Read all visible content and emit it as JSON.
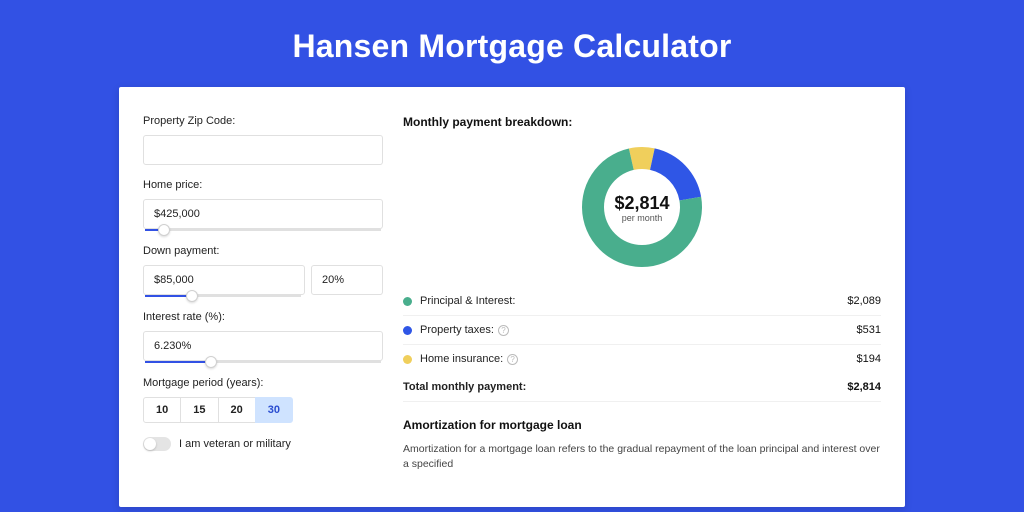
{
  "page_title": "Hansen Mortgage Calculator",
  "form": {
    "zip": {
      "label": "Property Zip Code:",
      "value": ""
    },
    "home_price": {
      "label": "Home price:",
      "value": "$425,000",
      "slider_pct": 8
    },
    "down_payment": {
      "label": "Down payment:",
      "amount": "$85,000",
      "percent": "20%",
      "slider_pct": 18
    },
    "interest": {
      "label": "Interest rate (%):",
      "value": "6.230%",
      "slider_pct": 28
    },
    "period": {
      "label": "Mortgage period (years):",
      "options": [
        "10",
        "15",
        "20",
        "30"
      ],
      "selected": "30"
    },
    "veteran": {
      "label": "I am veteran or military",
      "on": false
    }
  },
  "breakdown": {
    "title": "Monthly payment breakdown:",
    "center_amount": "$2,814",
    "center_sub": "per month",
    "items": [
      {
        "key": "pi",
        "label": "Principal & Interest:",
        "value": "$2,089",
        "color": "#49ae8d",
        "info": false
      },
      {
        "key": "tax",
        "label": "Property taxes:",
        "value": "$531",
        "color": "#2f56e6",
        "info": true
      },
      {
        "key": "ins",
        "label": "Home insurance:",
        "value": "$194",
        "color": "#f0cf5c",
        "info": true
      }
    ],
    "total": {
      "label": "Total monthly payment:",
      "value": "$2,814"
    }
  },
  "amort": {
    "title": "Amortization for mortgage loan",
    "text": "Amortization for a mortgage loan refers to the gradual repayment of the loan principal and interest over a specified"
  },
  "chart_data": {
    "type": "pie",
    "title": "Monthly payment breakdown",
    "series": [
      {
        "name": "Principal & Interest",
        "value": 2089,
        "color": "#49ae8d"
      },
      {
        "name": "Property taxes",
        "value": 531,
        "color": "#2f56e6"
      },
      {
        "name": "Home insurance",
        "value": 194,
        "color": "#f0cf5c"
      }
    ],
    "total": 2814,
    "inner_radius_pct": 62
  }
}
